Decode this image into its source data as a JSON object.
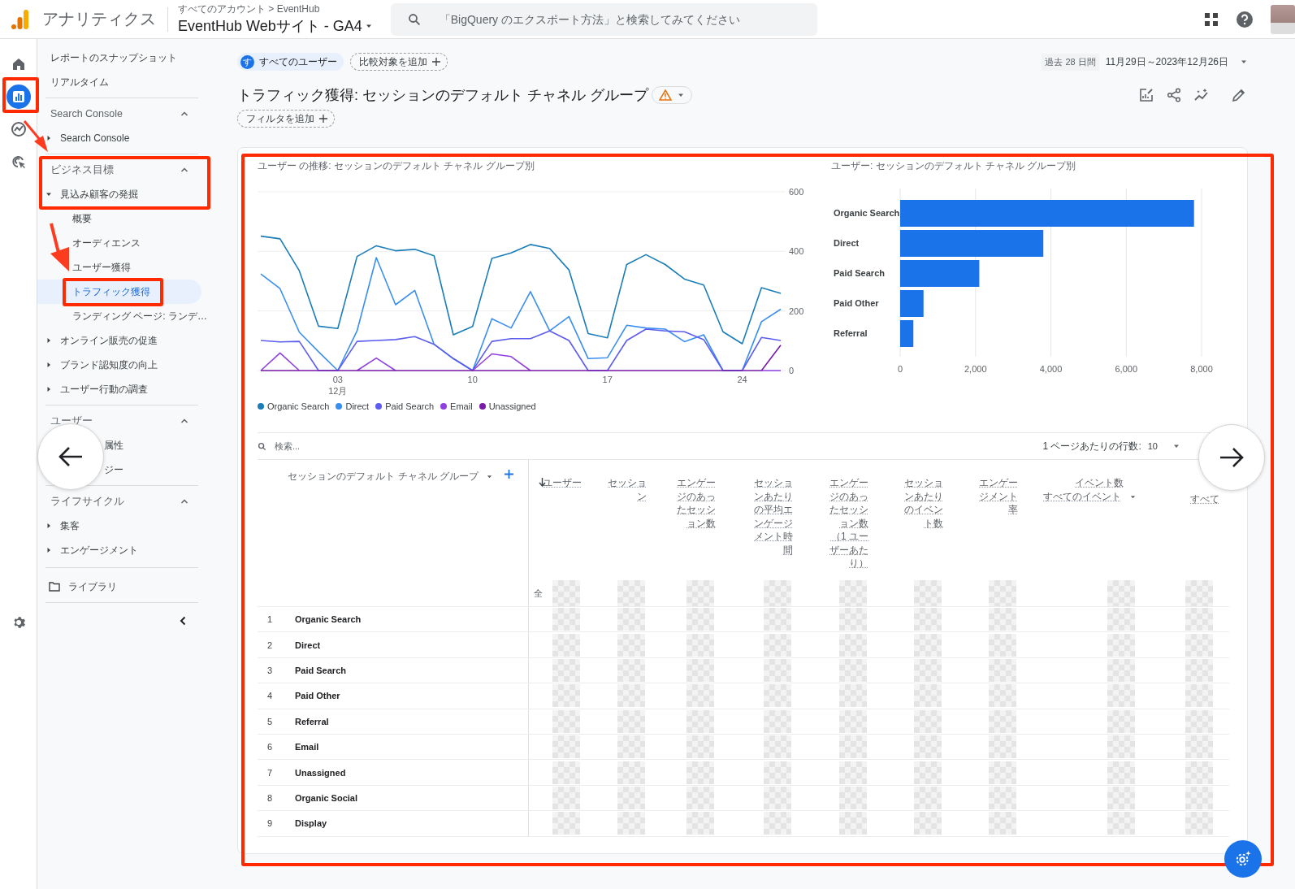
{
  "header": {
    "app_name": "アナリティクス",
    "breadcrumb": "すべてのアカウント > EventHub",
    "property": "EventHub Webサイト - GA4",
    "search": {
      "placeholder": "「BigQuery のエクスポート方法」と検索してみてください"
    }
  },
  "rail": [
    {
      "kind": "home",
      "selected": false
    },
    {
      "kind": "reports",
      "selected": true
    },
    {
      "kind": "explore",
      "selected": false
    },
    {
      "kind": "advertising",
      "selected": false
    }
  ],
  "sidebar": {
    "top_links": [
      "レポートのスナップショット",
      "リアルタイム"
    ],
    "sections": [
      {
        "title": "Search Console",
        "expanded": true,
        "items": [
          {
            "kind": "group",
            "label": "Search Console",
            "expanded": false
          }
        ]
      },
      {
        "title": "ビジネス目標",
        "expanded": true,
        "items": [
          {
            "kind": "group",
            "label": "見込み顧客の発掘",
            "expanded": true,
            "children": [
              {
                "label": "概要",
                "selected": false
              },
              {
                "label": "オーディエンス",
                "selected": false
              },
              {
                "label": "ユーザー獲得",
                "selected": false
              },
              {
                "label": "トラフィック獲得",
                "selected": true
              },
              {
                "label": "ランディング ページ: ランデ…",
                "selected": false
              }
            ]
          },
          {
            "kind": "group",
            "label": "オンライン販売の促進",
            "expanded": false
          },
          {
            "kind": "group",
            "label": "ブランド認知度の向上",
            "expanded": false
          },
          {
            "kind": "group",
            "label": "ユーザー行動の調査",
            "expanded": false
          }
        ]
      },
      {
        "title": "ユーザー",
        "expanded": true,
        "items": [
          {
            "kind": "covered",
            "label": "属性"
          },
          {
            "kind": "covered",
            "label": "ジー"
          }
        ]
      },
      {
        "title": "ライフサイクル",
        "expanded": true,
        "items": [
          {
            "kind": "group",
            "label": "集客",
            "expanded": false
          },
          {
            "kind": "group",
            "label": "エンゲージメント",
            "expanded": false
          }
        ]
      }
    ],
    "library": "ライブラリ"
  },
  "toolbar": {
    "segment": {
      "badge": "す",
      "label": "すべてのユーザー"
    },
    "compare": "比較対象を追加",
    "date_preset": "過去 28 日間",
    "date_range": "11月29日～2023年12月26日"
  },
  "title": "トラフィック獲得: セッションのデフォルト チャネル グループ",
  "add_filter": "フィルタを追加",
  "line_chart": {
    "month_label": "12月",
    "chart_data": {
      "type": "line",
      "title": "ユーザー の推移: セッションのデフォルト チャネル グループ別",
      "categories": [
        null,
        null,
        null,
        null,
        "03",
        null,
        null,
        null,
        null,
        null,
        null,
        "10",
        null,
        null,
        null,
        null,
        null,
        null,
        "17",
        null,
        null,
        null,
        null,
        null,
        null,
        "24",
        null,
        null
      ],
      "ylim": [
        0,
        600
      ],
      "yticks": [
        0,
        200,
        400,
        600
      ],
      "grid": true,
      "series": [
        {
          "name": "Organic Search",
          "color": "#1a7db8",
          "values": [
            451,
            442,
            335,
            149,
            141,
            383,
            419,
            402,
            407,
            385,
            120,
            148,
            376,
            395,
            423,
            410,
            338,
            124,
            110,
            356,
            389,
            356,
            307,
            287,
            130,
            90,
            278,
            259
          ]
        },
        {
          "name": "Direct",
          "color": "#3a8ef0",
          "values": [
            324,
            275,
            129,
            63,
            0,
            133,
            379,
            221,
            269,
            88,
            40,
            0,
            174,
            143,
            265,
            133,
            181,
            40,
            43,
            152,
            143,
            139,
            97,
            120,
            0,
            0,
            164,
            206
          ]
        },
        {
          "name": "Paid Search",
          "color": "#5c5cf0",
          "values": [
            101,
            96,
            98,
            0,
            0,
            98,
            101,
            104,
            114,
            88,
            40,
            0,
            98,
            107,
            107,
            133,
            101,
            0,
            0,
            101,
            139,
            133,
            130,
            104,
            0,
            0,
            111,
            101
          ]
        },
        {
          "name": "Email",
          "color": "#9040e0",
          "values": [
            0,
            59,
            0,
            null,
            null,
            0,
            42,
            0,
            null,
            null,
            null,
            0,
            56,
            47,
            0,
            null,
            null,
            null,
            null,
            null,
            null,
            null,
            null,
            null,
            null,
            null,
            0,
            0
          ]
        },
        {
          "name": "Unassigned",
          "color": "#7a1ba8",
          "values": [
            0,
            0,
            0,
            0,
            0,
            0,
            0,
            0,
            0,
            0,
            0,
            0,
            0,
            0,
            0,
            0,
            0,
            0,
            0,
            0,
            0,
            0,
            0,
            0,
            0,
            0,
            0,
            85
          ]
        }
      ]
    }
  },
  "bar_chart": {
    "chart_data": {
      "type": "bar",
      "orientation": "horizontal",
      "title": "ユーザー: セッションのデフォルト チャネル グループ別",
      "categories": [
        "Organic Search",
        "Direct",
        "Paid Search",
        "Paid Other",
        "Referral"
      ],
      "values": [
        7800,
        3800,
        2100,
        620,
        350
      ],
      "xlim": [
        0,
        8000
      ],
      "grid": true,
      "xticks": [
        {
          "value": 0,
          "label": "0"
        },
        {
          "value": 2000,
          "label": "2,000"
        },
        {
          "value": 4000,
          "label": "4,000"
        },
        {
          "value": 6000,
          "label": "6,000"
        },
        {
          "value": 8000,
          "label": "8,000"
        }
      ]
    }
  },
  "table": {
    "search_placeholder": "検索...",
    "rows_per_page_label": "1 ページあたりの行数:",
    "rows_per_page": "10",
    "dimension_header": "セッションのデフォルト チャネル グループ",
    "columns": [
      {
        "label": "ユーザー",
        "sorted": true
      },
      {
        "label": "セッション",
        "sorted": false
      },
      {
        "label": "エンゲージのあったセッション数",
        "sorted": false
      },
      {
        "label": "セッションあたりの平均エンゲージメント時間",
        "sorted": false
      },
      {
        "label": "エンゲージのあったセッション数（1 ユーザーあたり）",
        "sorted": false
      },
      {
        "label": "セッションあたりのイベント数",
        "sorted": false
      },
      {
        "label": "エンゲージメント率",
        "sorted": false
      },
      {
        "label": "イベント数",
        "sub": "すべてのイベント",
        "sorted": false
      },
      {
        "sub": "すべて",
        "sorted": false
      }
    ],
    "total_label": "全",
    "rows": [
      {
        "index": "1",
        "channel": "Organic Search"
      },
      {
        "index": "2",
        "channel": "Direct"
      },
      {
        "index": "3",
        "channel": "Paid Search"
      },
      {
        "index": "4",
        "channel": "Paid Other"
      },
      {
        "index": "5",
        "channel": "Referral"
      },
      {
        "index": "6",
        "channel": "Email"
      },
      {
        "index": "7",
        "channel": "Unassigned"
      },
      {
        "index": "8",
        "channel": "Organic Social"
      },
      {
        "index": "9",
        "channel": "Display"
      }
    ]
  }
}
